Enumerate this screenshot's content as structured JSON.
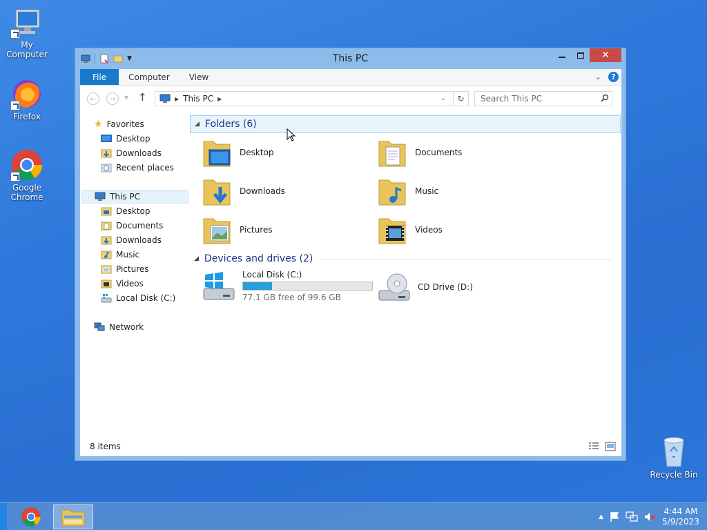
{
  "desktop": {
    "icons": [
      {
        "label": "My Computer"
      },
      {
        "label": "Firefox"
      },
      {
        "label": "Google Chrome"
      }
    ],
    "recycle_bin": "Recycle Bin"
  },
  "window": {
    "title": "This PC",
    "ribbon_tabs": {
      "file": "File",
      "computer": "Computer",
      "view": "View"
    },
    "address": {
      "path": "This PC"
    },
    "search": {
      "placeholder": "Search This PC"
    },
    "nav": {
      "favorites": "Favorites",
      "fav_items": [
        "Desktop",
        "Downloads",
        "Recent places"
      ],
      "this_pc": "This PC",
      "pc_items": [
        "Desktop",
        "Documents",
        "Downloads",
        "Music",
        "Pictures",
        "Videos",
        "Local Disk (C:)"
      ],
      "network": "Network"
    },
    "groups": {
      "folders_header": "Folders (6)",
      "folders": [
        "Desktop",
        "Documents",
        "Downloads",
        "Music",
        "Pictures",
        "Videos"
      ],
      "devices_header": "Devices and drives (2)",
      "local_disk": {
        "name": "Local Disk (C:)",
        "free_text": "77.1 GB free of 99.6 GB",
        "used_fraction": 0.226
      },
      "cd_drive": {
        "name": "CD Drive (D:)"
      }
    },
    "status": {
      "items": "8 items"
    }
  },
  "taskbar": {
    "time": "4:44 AM",
    "date": "5/9/2023"
  }
}
